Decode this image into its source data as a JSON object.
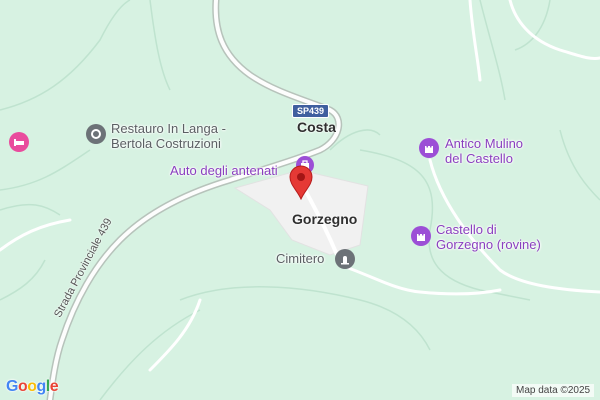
{
  "map": {
    "towns": {
      "costa": "Costa",
      "gorzegno": "Gorzegno"
    },
    "road_shield": "SP439",
    "road_name": "Strada Provinciale 439",
    "pois": {
      "restauro": {
        "line1": "Restauro In Langa -",
        "line2": "Bertola Costruzioni",
        "icon": "pin-circle-icon"
      },
      "antenati": {
        "label": "Auto degli antenati",
        "icon": "bag-icon"
      },
      "mulino": {
        "line1": "Antico Mulino",
        "line2": "del Castello",
        "icon": "castle-icon"
      },
      "castello": {
        "line1": "Castello di",
        "line2": "Gorzegno (rovine)",
        "icon": "castle-icon"
      },
      "cimitero": {
        "label": "Cimitero",
        "icon": "cemetery-icon"
      }
    },
    "logo": "Google",
    "attribution": "Map data ©2025",
    "colors": {
      "land": "#d7f2e2",
      "town": "#f1f1f1",
      "purple": "#9c4fd6",
      "gray": "#6c7277",
      "pin": "#e53935"
    }
  }
}
